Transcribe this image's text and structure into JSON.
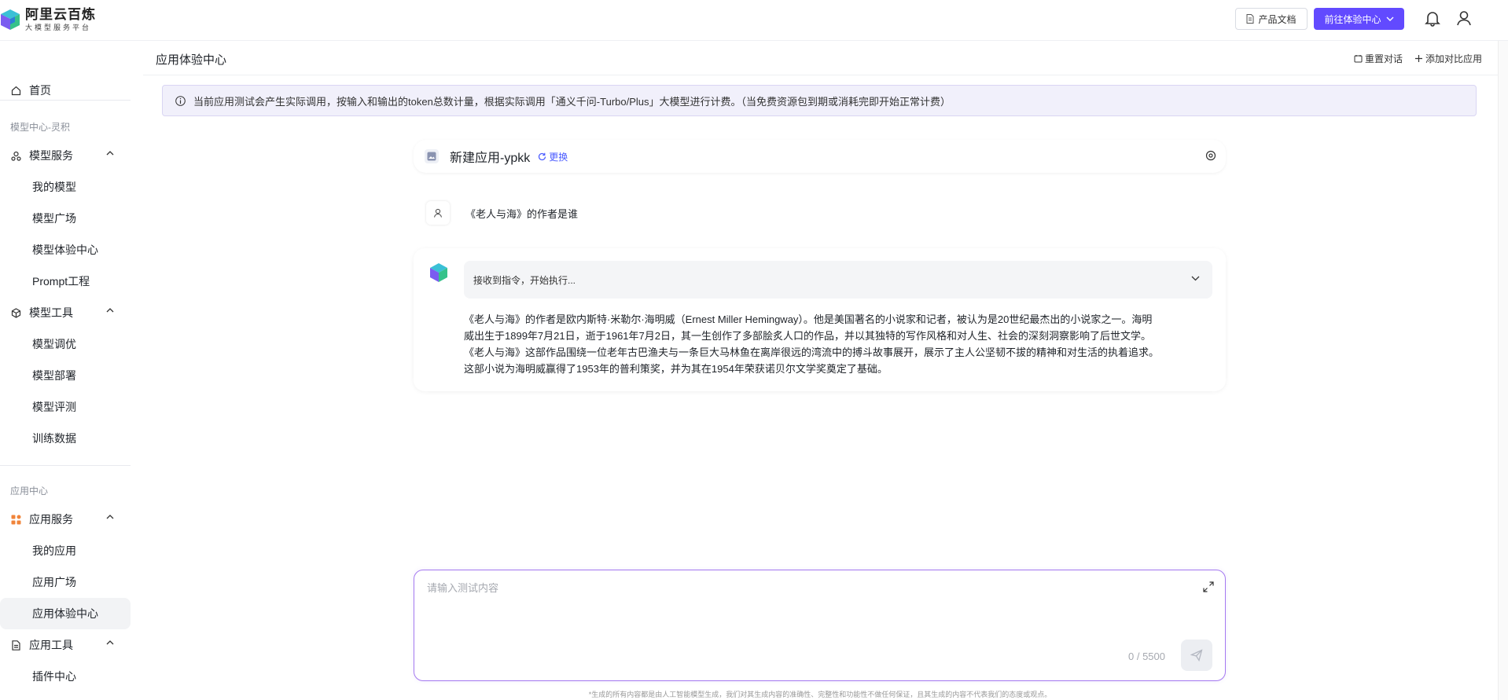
{
  "header": {
    "logo_title": "阿里云百炼",
    "logo_subtitle": "大模型服务平台",
    "docs_label": "产品文档",
    "goto_label": "前往体验中心"
  },
  "sidebar": {
    "home": "首页",
    "group1_label": "模型中心-灵积",
    "model_service": "模型服务",
    "my_models": "我的模型",
    "model_plaza": "模型广场",
    "model_center": "模型体验中心",
    "prompt": "Prompt工程",
    "model_tools": "模型工具",
    "model_tuning": "模型调优",
    "model_deploy": "模型部署",
    "model_eval": "模型评测",
    "train_data": "训练数据",
    "group2_label": "应用中心",
    "app_service": "应用服务",
    "my_apps": "我的应用",
    "app_plaza": "应用广场",
    "app_center": "应用体验中心",
    "app_tools": "应用工具",
    "plugin_center": "插件中心"
  },
  "main": {
    "title": "应用体验中心",
    "reset_label": "重置对话",
    "add_compare_label": "添加对比应用",
    "notice": "当前应用测试会产生实际调用，按输入和输出的token总数计量，根据实际调用「通义千问-Turbo/Plus」大模型进行计费。（当免费资源包到期或消耗完即开始正常计费）",
    "app_name": "新建应用-ypkk",
    "replace_label": "更换",
    "user_question": "《老人与海》的作者是谁",
    "exec_status": "接收到指令，开始执行...",
    "answer_lines": [
      "《老人与海》的作者是欧内斯特·米勒尔·海明威（Ernest Miller Hemingway）。他是美国著名的小说家和记者，被认为是20世纪最杰出的小说家之一。海明",
      "威出生于1899年7月21日，逝于1961年7月2日，其一生创作了多部脍炙人口的作品，并以其独特的写作风格和对人生、社会的深刻洞察影响了后世文学。",
      "《老人与海》这部作品围绕一位老年古巴渔夫与一条巨大马林鱼在离岸很远的湾流中的搏斗故事展开，展示了主人公坚韧不拔的精神和对生活的执着追求。",
      "这部小说为海明威赢得了1953年的普利策奖，并为其在1954年荣获诺贝尔文学奖奠定了基础。"
    ],
    "input_placeholder": "请输入测试内容",
    "counter": "0 / 5500",
    "footnote": "*生成的所有内容都是由人工智能模型生成，我们对其生成内容的准确性、完整性和功能性不做任何保证，且其生成的内容不代表我们的态度或观点。"
  },
  "colors": {
    "brand": "#624aff",
    "link": "#4a5bff",
    "notice_bg": "#f1f0fb",
    "input_border": "#a57af0"
  }
}
